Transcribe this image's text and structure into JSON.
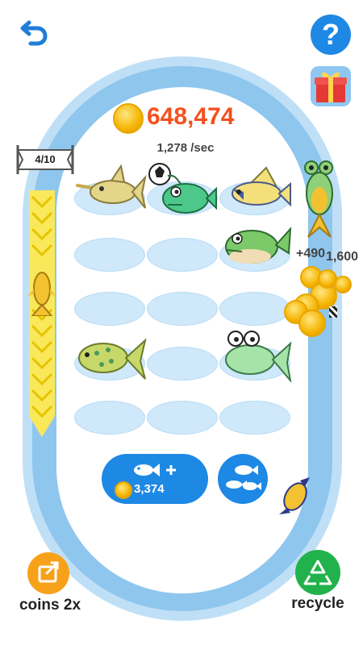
{
  "header": {
    "coin_total": "648,474",
    "rate": "1,278 /sec"
  },
  "progress": {
    "label": "4/10",
    "current": 4,
    "max": 10
  },
  "floating": {
    "reward_text": "+490",
    "reward_text2": "1,600"
  },
  "buy_button": {
    "price": "3,374"
  },
  "bottom": {
    "left_label": "coins 2x",
    "right_label": "recycle"
  },
  "icons": {
    "back": "back-arrow-icon",
    "help": "question-icon",
    "gift": "gift-icon",
    "share": "share-icon",
    "recycle": "recycle-icon"
  },
  "colors": {
    "accent_blue": "#1e88e5",
    "coin_text": "#f4511e",
    "pool_ring": "#8ec6ee",
    "share_orange": "#f7a11a",
    "recycle_green": "#21b24b"
  }
}
